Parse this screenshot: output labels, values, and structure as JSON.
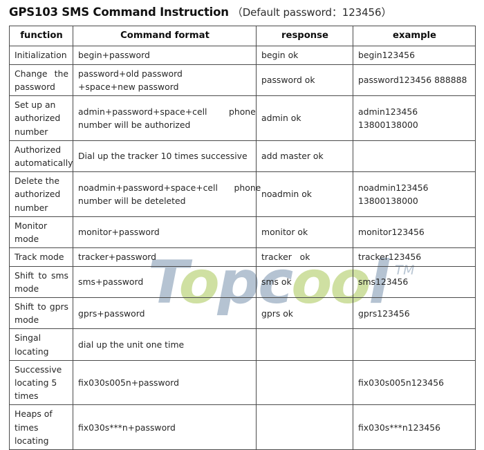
{
  "title": {
    "main": "GPS103 SMS Command Instruction",
    "note": "（Default password：123456）"
  },
  "watermark": {
    "text": "Topcool",
    "trademark": "TM",
    "color_blue": "#b5c3d2",
    "color_green": "#cfe0a2",
    "segments": [
      {
        "text": "T",
        "color": "blue"
      },
      {
        "text": "o",
        "color": "green"
      },
      {
        "text": "p",
        "color": "blue"
      },
      {
        "text": "c",
        "color": "blue"
      },
      {
        "text": "o",
        "color": "green"
      },
      {
        "text": "o",
        "color": "green"
      },
      {
        "text": "l",
        "color": "blue"
      }
    ]
  },
  "table": {
    "headers": {
      "function": "function",
      "command": "Command format",
      "response": "response",
      "example": "example"
    },
    "rows": [
      {
        "function": "Initialization",
        "command": "begin+password",
        "response": "begin ok",
        "example": "begin123456"
      },
      {
        "function": "Change the\npassword",
        "command": "password+old password\n+space+new password",
        "response": "password ok",
        "example": "password123456 888888"
      },
      {
        "function": "Set up an\nauthorized\nnumber",
        "command": "admin+password+space+cell        phone\nnumber will be authorized",
        "response": "admin ok",
        "example": "admin123456 13800138000"
      },
      {
        "function": "Authorized\nautomatically",
        "command": "Dial up the tracker 10 times successive",
        "response": "add master ok",
        "example": ""
      },
      {
        "function": "Delete the\nauthorized\nnumber",
        "command": "noadmin+password+space+cell      phone\nnumber will be deteleted",
        "response": "noadmin ok",
        "example": "noadmin123456\n13800138000"
      },
      {
        "function": "Monitor\nmode",
        "command": "monitor+password",
        "response": "monitor ok",
        "example": "monitor123456"
      },
      {
        "function": "Track mode",
        "command": "tracker+password",
        "response": "tracker   ok",
        "example": "tracker123456"
      },
      {
        "function": "Shift to sms\nmode",
        "command": "sms+password",
        "response": "sms ok",
        "example": "sms123456"
      },
      {
        "function": "Shift to gprs\nmode",
        "command": "gprs+password",
        "response": "gprs ok",
        "example": "gprs123456"
      },
      {
        "function": "Singal\nlocating",
        "command": "dial up the unit one time",
        "response": "",
        "example": ""
      },
      {
        "function": "Successive\nlocating 5\ntimes",
        "command": "fix030s005n+password",
        "response": "",
        "example": "fix030s005n123456"
      },
      {
        "function": "Heaps of\ntimes\nlocating",
        "command": "fix030s***n+password",
        "response": "",
        "example": "fix030s***n123456"
      }
    ]
  }
}
